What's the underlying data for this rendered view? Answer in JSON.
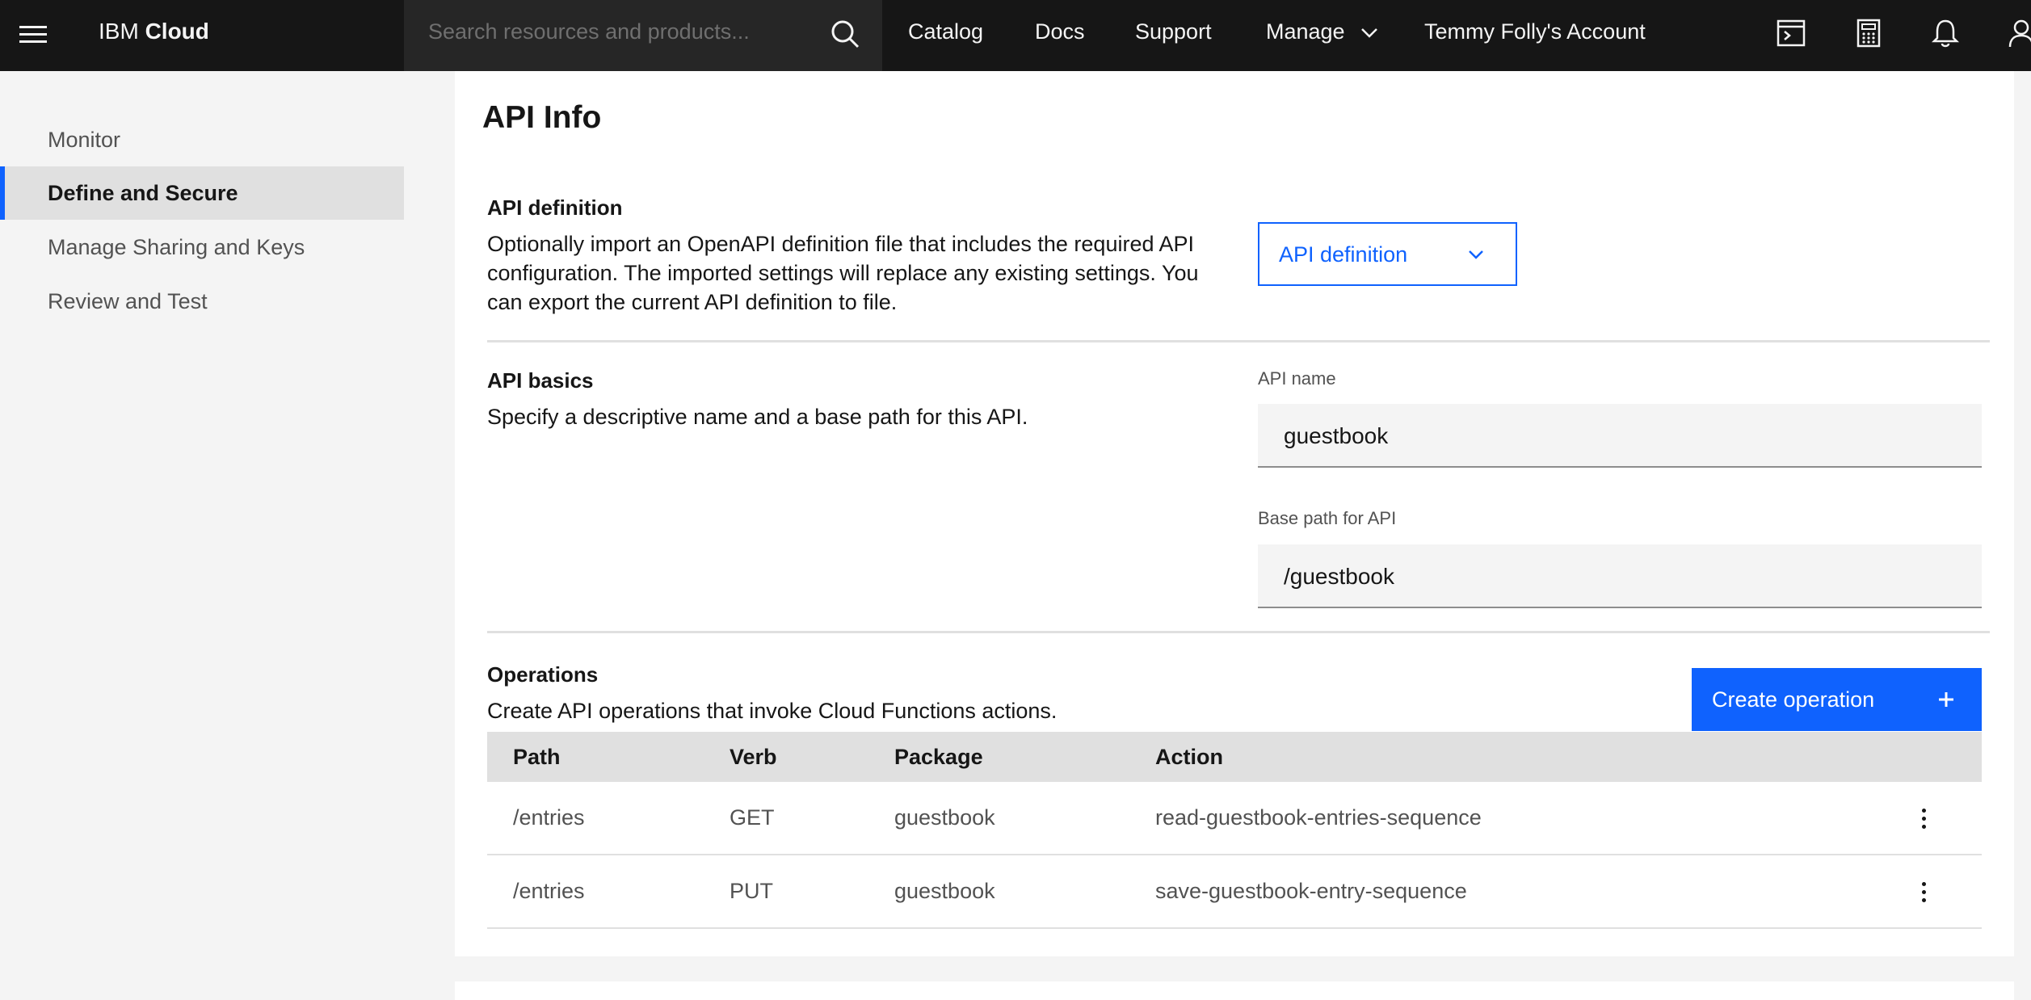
{
  "header": {
    "brand_prefix": "IBM",
    "brand_name": "Cloud",
    "search_placeholder": "Search resources and products...",
    "nav": {
      "catalog": "Catalog",
      "docs": "Docs",
      "support": "Support",
      "manage": "Manage",
      "account": "Temmy Folly's Account"
    },
    "icons": [
      "terminal-icon",
      "calculator-icon",
      "notification-icon",
      "user-icon"
    ]
  },
  "sidenav": {
    "items": [
      {
        "label": "Monitor"
      },
      {
        "label": "Define and Secure"
      },
      {
        "label": "Manage Sharing and Keys"
      },
      {
        "label": "Review and Test"
      }
    ],
    "active": "Define and Secure"
  },
  "main": {
    "title": "API Info",
    "definition": {
      "title": "API definition",
      "description": "Optionally import an OpenAPI definition file that includes the required API configuration. The imported settings will replace any existing settings. You can export the current API definition to file.",
      "dropdown_label": "API definition"
    },
    "basics": {
      "title": "API basics",
      "description": "Specify a descriptive name and a base path for this API.",
      "name_label": "API name",
      "name_value": "guestbook",
      "path_label": "Base path for API",
      "path_value": "/guestbook"
    },
    "operations": {
      "title": "Operations",
      "description": "Create API operations that invoke Cloud Functions actions.",
      "create_button": "Create operation",
      "columns": [
        "Path",
        "Verb",
        "Package",
        "Action"
      ],
      "rows": [
        {
          "path": "/entries",
          "verb": "GET",
          "package": "guestbook",
          "action": "read-guestbook-entries-sequence"
        },
        {
          "path": "/entries",
          "verb": "PUT",
          "package": "guestbook",
          "action": "save-guestbook-entry-sequence"
        }
      ]
    }
  },
  "colors": {
    "accent": "#0f62fe",
    "header_bg": "#161616",
    "page_bg": "#f4f4f4"
  }
}
